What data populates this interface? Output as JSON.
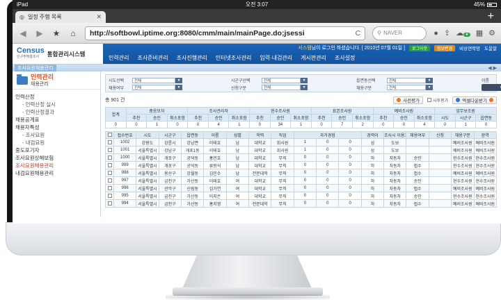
{
  "status": {
    "device": "iPad",
    "time": "오전 3:07",
    "battery": "45%"
  },
  "browser": {
    "tab_title": "일정 주행 목록",
    "url": "http://softbowl.iptime.org:8080/cmm/main/mainPage.do;jsessi",
    "search_placeholder": "NAVER",
    "new_tab_label": "+"
  },
  "app": {
    "logo_text": "Census",
    "logo_sub": "인구주택총조사",
    "system_name": "통합관리시스템",
    "welcome_name": "서스템",
    "welcome_text": "님이 로그인 하셨습니다. [ 2010년 07월 01일 ]",
    "header_buttons": [
      "로그아웃",
      "정보변경"
    ],
    "header_links": [
      "비상연락망",
      "도움말"
    ],
    "menu": [
      "인력관리",
      "조사준비관리",
      "조사진행관리",
      "인터넷조사관리",
      "입력·내검관리",
      "게시판관리",
      "조사설정"
    ],
    "sub_tab": "조사요원채용관리",
    "sub_pager": "◀ ▶"
  },
  "sidebar": {
    "title": "인력관리",
    "subtitle": "채용관리",
    "items": [
      {
        "label": "인력산정",
        "sub": false,
        "active": false
      },
      {
        "label": "- 인력산정 실시",
        "sub": true,
        "active": false
      },
      {
        "label": "- 인력산정결과",
        "sub": true,
        "active": false
      },
      {
        "label": "채용공계표",
        "sub": false,
        "active": false
      },
      {
        "label": "채용자특성",
        "sub": false,
        "active": false
      },
      {
        "label": "- 조사요원",
        "sub": true,
        "active": false
      },
      {
        "label": "- 내검요원",
        "sub": true,
        "active": false
      },
      {
        "label": "중도포기자",
        "sub": false,
        "active": false
      },
      {
        "label": "조사요원상해보험",
        "sub": false,
        "active": false
      },
      {
        "label": "조사요원채용관리",
        "sub": false,
        "active": true
      },
      {
        "label": "내검요원채용관리",
        "sub": false,
        "active": false
      }
    ]
  },
  "filters": {
    "row1": [
      {
        "label": "시도선택",
        "value": "전체"
      },
      {
        "label": "시군구선택",
        "value": "전체"
      },
      {
        "label": "읍면동선택",
        "value": "전체"
      }
    ],
    "row2": [
      {
        "label": "채용여부",
        "value": "전체"
      },
      {
        "label": "신청구분",
        "value": "전체"
      },
      {
        "label": "채용구분",
        "value": "전체"
      }
    ],
    "name_label": "이름",
    "search_button": "검색"
  },
  "toolbar": {
    "count": "총 901 건",
    "review_button": "사전평가",
    "check_label": "사후평가",
    "excel_button": "엑셀다운받기"
  },
  "summary": {
    "groups": [
      "총응모자",
      "조사관리자",
      "현수조사원",
      "표본조사원",
      "예비조사원"
    ],
    "subcols": [
      "추천",
      "승인",
      "취소포함"
    ],
    "extra_header": "업무보조원",
    "extra_subcols": [
      "시도",
      "시군구",
      "읍면동"
    ],
    "total_label": "합계",
    "values": [
      "0",
      "0",
      "1",
      "0",
      "0",
      "4",
      "1",
      "0",
      "34",
      "1",
      "0",
      "7",
      "2",
      "0",
      "0",
      "4",
      "0",
      "1",
      "0"
    ]
  },
  "table": {
    "headers": [
      "접수번호",
      "시도",
      "시군구",
      "읍면동",
      "이름",
      "성별",
      "학력",
      "직업",
      "과거경험",
      "경력이",
      "조사시 이용교통수단",
      "채용여부",
      "신청",
      "채용구분",
      "완역"
    ],
    "rows": [
      [
        "1002",
        "강원도",
        "강릉시",
        "강남면",
        "이태호",
        "남",
        "대학교",
        "회사원",
        "1",
        "0",
        "0",
        "삼",
        "도보",
        "",
        "",
        "예비조사원",
        "예비조사원"
      ],
      [
        "1001",
        "서울특별시",
        "강남구",
        "개포1동",
        "이태호",
        "남",
        "대학교",
        "회사원",
        "1",
        "0",
        "0",
        "삼",
        "도보",
        "",
        "",
        "예비조사원",
        "예비조사원"
      ],
      [
        "1000",
        "서울특별시",
        "개포구",
        "공덕동",
        "홍민호",
        "남",
        "대학교",
        "무직",
        "0",
        "0",
        "0",
        "하",
        "자동차",
        "승인",
        "",
        "현수조사원",
        "현수조사원"
      ],
      [
        "999",
        "서울특별시",
        "개포구",
        "공덕동",
        "류랑석",
        "남",
        "대학교",
        "무직",
        "0",
        "0",
        "0",
        "하",
        "자동차",
        "접수",
        "",
        "현수조사원",
        "현수조사원"
      ],
      [
        "998",
        "서울특별시",
        "용산구",
        "강월동",
        "김민수",
        "남",
        "전문대학",
        "무직",
        "0",
        "0",
        "0",
        "하",
        "자동차",
        "접수",
        "",
        "예비조사원",
        "예비조사원"
      ],
      [
        "997",
        "서울특별시",
        "금천구",
        "가산동",
        "이태호",
        "여",
        "대학교",
        "무직",
        "0",
        "0",
        "0",
        "하",
        "자동차",
        "승인",
        "",
        "현수조사원",
        "현수조사원"
      ],
      [
        "996",
        "서울특별시",
        "관악구",
        "신림동",
        "김가연",
        "여",
        "대학교",
        "무직",
        "0",
        "0",
        "0",
        "하",
        "자동차",
        "접수",
        "",
        "예비조사원",
        "예비조사원"
      ],
      [
        "995",
        "서울특별시",
        "금천구",
        "가산동",
        "이지은",
        "여",
        "대학교",
        "무직",
        "0",
        "0",
        "0",
        "하",
        "자동차",
        "승인",
        "",
        "현수조사원",
        "현수조사원"
      ],
      [
        "994",
        "서울특별시",
        "금천구",
        "가산동",
        "홍지영",
        "여",
        "전문대학",
        "무직",
        "0",
        "0",
        "0",
        "하",
        "자동차",
        "접수",
        "",
        "예비조사원",
        "예비조사원"
      ]
    ]
  }
}
